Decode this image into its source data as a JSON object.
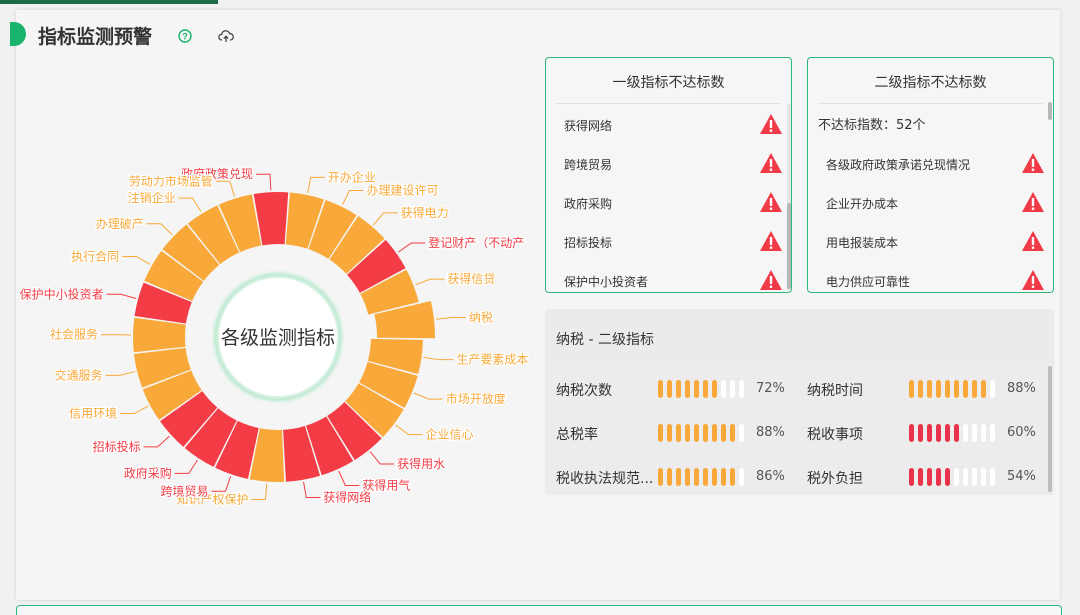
{
  "header": {
    "title": "指标监测预警",
    "help_icon": "help-circle-icon",
    "upload_icon": "cloud-upload-icon"
  },
  "donut": {
    "center_label": "各级监测指标",
    "colors": {
      "ok": "#f8a93a",
      "bad": "#f33c45"
    },
    "segments": [
      {
        "label": "政府政策兑现",
        "status": "bad"
      },
      {
        "label": "开办企业",
        "status": "ok"
      },
      {
        "label": "办理建设许可",
        "status": "ok"
      },
      {
        "label": "获得电力",
        "status": "ok"
      },
      {
        "label": "登记财产（不动产",
        "status": "bad"
      },
      {
        "label": "获得信贷",
        "status": "ok"
      },
      {
        "label": "纳税",
        "status": "ok",
        "highlight": true
      },
      {
        "label": "生产要素成本",
        "status": "ok"
      },
      {
        "label": "市场开放度",
        "status": "ok"
      },
      {
        "label": "企业信心",
        "status": "ok"
      },
      {
        "label": "获得用水",
        "status": "bad"
      },
      {
        "label": "获得用气",
        "status": "bad"
      },
      {
        "label": "获得网络",
        "status": "bad"
      },
      {
        "label": "知识产权保护",
        "status": "ok"
      },
      {
        "label": "跨境贸易",
        "status": "bad"
      },
      {
        "label": "政府采购",
        "status": "bad"
      },
      {
        "label": "招标投标",
        "status": "bad"
      },
      {
        "label": "信用环境",
        "status": "ok"
      },
      {
        "label": "交通服务",
        "status": "ok"
      },
      {
        "label": "社会服务",
        "status": "ok"
      },
      {
        "label": "保护中小投资者",
        "status": "bad"
      },
      {
        "label": "执行合同",
        "status": "ok"
      },
      {
        "label": "办理破产",
        "status": "ok"
      },
      {
        "label": "注销企业",
        "status": "ok"
      },
      {
        "label": "劳动力市场监管",
        "status": "ok"
      }
    ]
  },
  "level1": {
    "title": "一级指标不达标数",
    "items": [
      "获得网络",
      "跨境贸易",
      "政府采购",
      "招标投标",
      "保护中小投资者"
    ]
  },
  "level2": {
    "title": "二级指标不达标数",
    "count_text": "不达标指数：52个",
    "items": [
      "各级政府政策承诺兑现情况",
      "企业开办成本",
      "用电报装成本",
      "电力供应可靠性"
    ]
  },
  "tax": {
    "title": "纳税 - 二级指标",
    "colors": {
      "orange": "#f8a93a",
      "red": "#e8334a",
      "empty": "#ffffff"
    },
    "metrics": [
      {
        "label": "纳税次数",
        "value": 72,
        "pct": "72%",
        "color": "orange"
      },
      {
        "label": "纳税时间",
        "value": 88,
        "pct": "88%",
        "color": "orange"
      },
      {
        "label": "总税率",
        "value": 88,
        "pct": "88%",
        "color": "orange"
      },
      {
        "label": "税收事项",
        "value": 60,
        "pct": "60%",
        "color": "red"
      },
      {
        "label": "税收执法规范...",
        "value": 86,
        "pct": "86%",
        "color": "orange"
      },
      {
        "label": "税外负担",
        "value": 54,
        "pct": "54%",
        "color": "red"
      }
    ]
  }
}
